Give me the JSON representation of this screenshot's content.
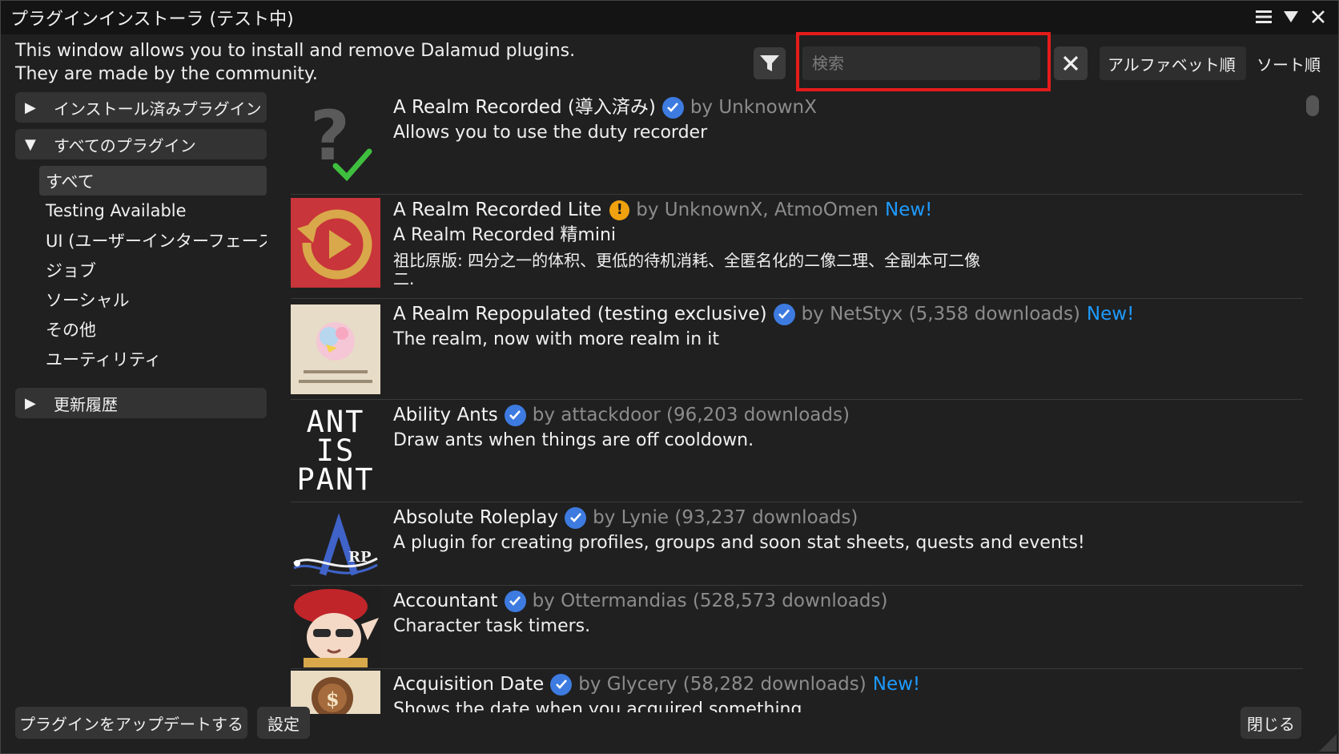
{
  "window": {
    "title": "プラグインインストーラ (テスト中)"
  },
  "header": {
    "intro_line1": "This window allows you to install and remove Dalamud plugins.",
    "intro_line2": "They are made by the community.",
    "search_placeholder": "検索",
    "sort_value": "アルファベット順",
    "sort_label": "ソート順"
  },
  "sidebar": {
    "installed_label": "インストール済みプラグイン",
    "all_label": "すべてのプラグイン",
    "categories": [
      "すべて",
      "Testing Available",
      "UI (ユーザーインターフェース)",
      "ジョブ",
      "ソーシャル",
      "その他",
      "ユーティリティ"
    ],
    "selected_category": "すべて",
    "changelog_label": "更新履歴"
  },
  "plugins": [
    {
      "name": "A Realm Recorded (導入済み)",
      "badge": "verified",
      "author": "by UnknownX",
      "new": "",
      "desc": "Allows you to use the duty recorder",
      "desc2": "",
      "desc3": ""
    },
    {
      "name": "A Realm Recorded Lite",
      "badge": "warning",
      "author": "by UnknownX, AtmoOmen",
      "new": "New!",
      "desc": "A Realm Recorded 精mini",
      "desc2": "祖比原版: 四分之一的体积、更低的待机消耗、全匿名化的二像二理、全副本可二像",
      "desc3": "二."
    },
    {
      "name": "A Realm Repopulated (testing exclusive)",
      "badge": "verified",
      "author": "by NetStyx (5,358 downloads)",
      "new": "New!",
      "desc": "The realm, now with more realm in it",
      "desc2": "",
      "desc3": ""
    },
    {
      "name": "Ability Ants",
      "badge": "verified",
      "author": "by attackdoor (96,203 downloads)",
      "new": "",
      "desc": "Draw ants when things are off cooldown.",
      "desc2": "",
      "desc3": ""
    },
    {
      "name": "Absolute Roleplay",
      "badge": "verified",
      "author": "by Lynie (93,237 downloads)",
      "new": "",
      "desc": "A plugin for creating profiles, groups and soon stat sheets, quests and events!",
      "desc2": "",
      "desc3": ""
    },
    {
      "name": "Accountant",
      "badge": "verified",
      "author": "by Ottermandias (528,573 downloads)",
      "new": "",
      "desc": "Character task timers.",
      "desc2": "",
      "desc3": ""
    },
    {
      "name": "Acquisition Date",
      "badge": "verified",
      "author": "by Glycery (58,282 downloads)",
      "new": "New!",
      "desc": "Shows the date when you acquired something",
      "desc2": "",
      "desc3": ""
    }
  ],
  "icons": {
    "plugin1": "question-check-icon",
    "plugin2": "replay-circle-icon",
    "plugin3": "chocobo-art-icon",
    "plugin4": "ant-is-pant-text-icon",
    "plugin5": "arp-logo-icon",
    "plugin6": "red-hat-character-icon",
    "plugin7": "coin-bag-icon"
  },
  "icon_texts": {
    "ants_line1": "ANT",
    "ants_line2": "IS",
    "ants_line3": "PANT",
    "arp": "RP"
  },
  "footer": {
    "update_button": "プラグインをアップデートする",
    "settings_button": "設定",
    "close_button": "閉じる"
  },
  "colors": {
    "accent_new": "#1e9bff",
    "verified": "#3d7be0",
    "warning": "#f0a10f",
    "highlight": "#e61b1b"
  }
}
